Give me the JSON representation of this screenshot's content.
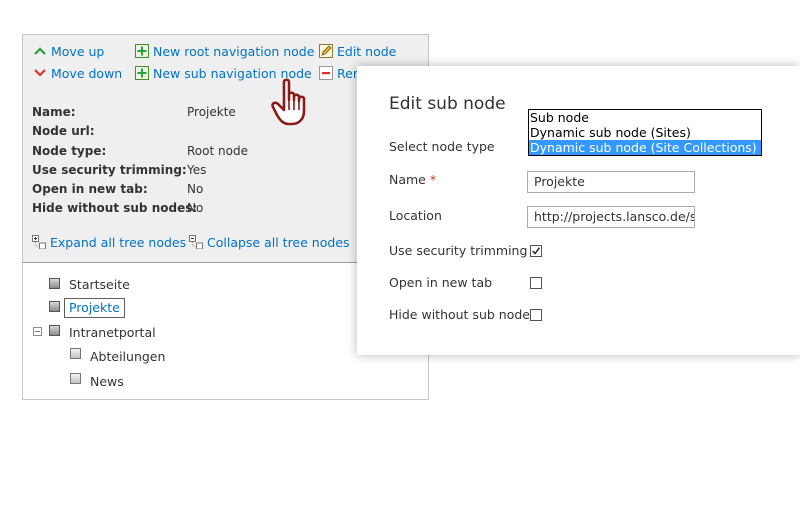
{
  "toolbar": {
    "move_up": "Move up",
    "move_down": "Move down",
    "new_root": "New root navigation node",
    "new_sub": "New sub navigation node",
    "edit_node": "Edit node",
    "remove": "Rem"
  },
  "properties": {
    "name_label": "Name:",
    "name_value": "Projekte",
    "url_label": "Node url:",
    "url_value": "",
    "type_label": "Node type:",
    "type_value": "Root node",
    "security_label": "Use security trimming:",
    "security_value": "Yes",
    "newtab_label": "Open in new tab",
    "newtab_label_colon": "Open in new tab:",
    "newtab_value": "No",
    "hide_label": "Hide without sub nodes:",
    "hide_value": "No"
  },
  "tree_actions": {
    "expand_all": "Expand all tree nodes",
    "collapse_all": "Collapse all tree nodes"
  },
  "tree": {
    "startseite": "Startseite",
    "projekte": "Projekte",
    "intranetportal": "Intranetportal",
    "abteilungen": "Abteilungen",
    "news": "News"
  },
  "dialog": {
    "title": "Edit sub node",
    "select_type_label": "Select node type",
    "node_types": [
      "Sub node",
      "Dynamic sub node (Sites)",
      "Dynamic sub node (Site Collections)"
    ],
    "selected_type_index": 2,
    "name_label": "Name",
    "required_mark": "*",
    "name_value": "Projekte",
    "location_label": "Location",
    "location_value": "http://projects.lansco.de/sites",
    "security_label": "Use security trimming",
    "security_checked": true,
    "newtab_label": "Open in new tab",
    "newtab_checked": false,
    "hide_label": "Hide without sub nodes",
    "hide_checked": false
  },
  "colors": {
    "link": "#0072c6",
    "panel_bg": "#efefef",
    "selection": "#3399ff",
    "up_arrow": "#2e9e3e",
    "down_arrow": "#d9342b",
    "cursor": "#8b1a1a"
  }
}
